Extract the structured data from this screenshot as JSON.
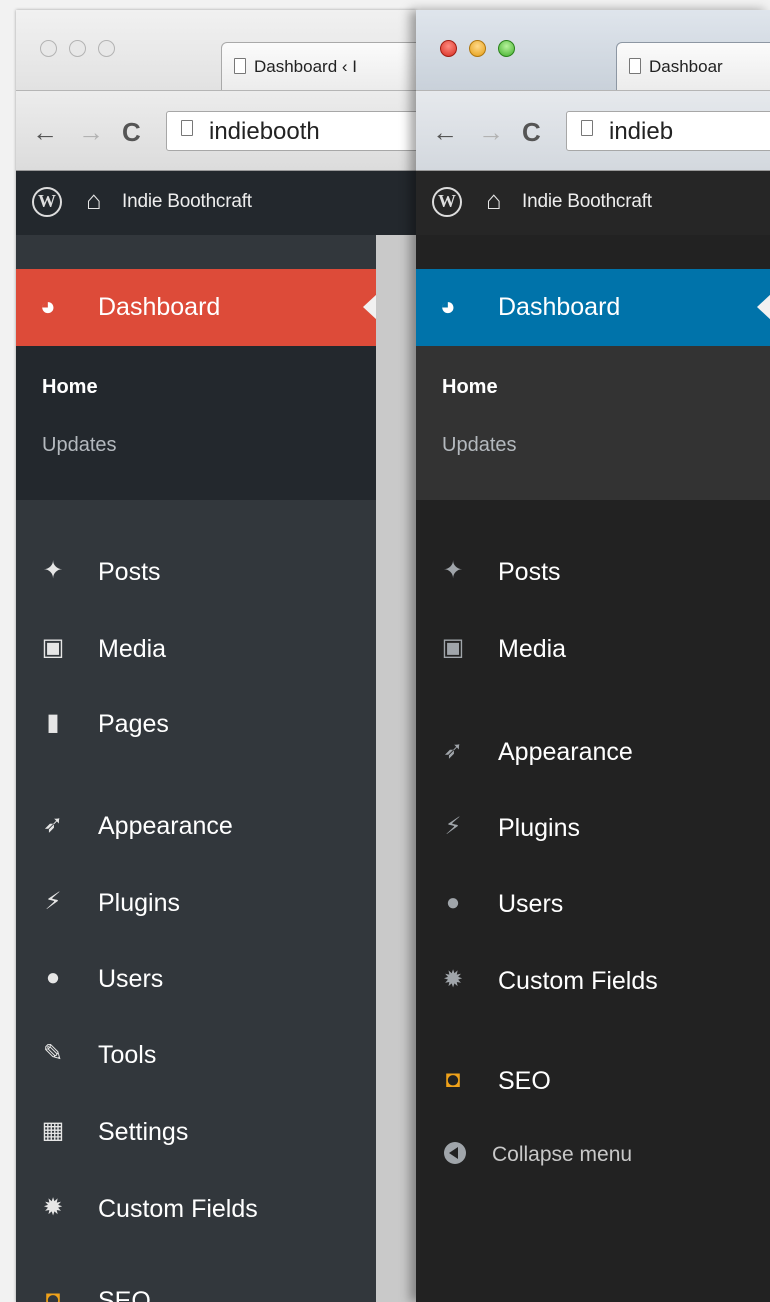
{
  "left_window": {
    "tab_title": "Dashboard ‹ I",
    "address": "indiebooth",
    "admin_bar": {
      "site_name": "Indie Boothcraft"
    },
    "accent_color": "#dd4b39",
    "menu": {
      "dashboard": "Dashboard",
      "submenu": {
        "home": "Home",
        "updates": "Updates"
      },
      "items": [
        {
          "label": "Posts",
          "icon": "pushpin-icon"
        },
        {
          "label": "Media",
          "icon": "media-icon"
        },
        {
          "label": "Pages",
          "icon": "pages-icon"
        },
        {
          "label": "Appearance",
          "icon": "paintbrush-icon"
        },
        {
          "label": "Plugins",
          "icon": "plugin-icon"
        },
        {
          "label": "Users",
          "icon": "user-icon"
        },
        {
          "label": "Tools",
          "icon": "wrench-icon"
        },
        {
          "label": "Settings",
          "icon": "settings-icon"
        },
        {
          "label": "Custom Fields",
          "icon": "gear-icon"
        },
        {
          "label": "SEO",
          "icon": "seo-icon"
        }
      ]
    }
  },
  "right_window": {
    "tab_title": "Dashboar",
    "address": "indieb",
    "admin_bar": {
      "site_name": "Indie Boothcraft"
    },
    "accent_color": "#0073aa",
    "menu": {
      "dashboard": "Dashboard",
      "submenu": {
        "home": "Home",
        "updates": "Updates"
      },
      "items": [
        {
          "label": "Posts",
          "icon": "pushpin-icon"
        },
        {
          "label": "Media",
          "icon": "media-icon"
        },
        {
          "label": "Appearance",
          "icon": "paintbrush-icon"
        },
        {
          "label": "Plugins",
          "icon": "plugin-icon"
        },
        {
          "label": "Users",
          "icon": "user-icon"
        },
        {
          "label": "Custom Fields",
          "icon": "gear-icon"
        },
        {
          "label": "SEO",
          "icon": "seo-icon"
        }
      ],
      "collapse": "Collapse menu"
    }
  }
}
